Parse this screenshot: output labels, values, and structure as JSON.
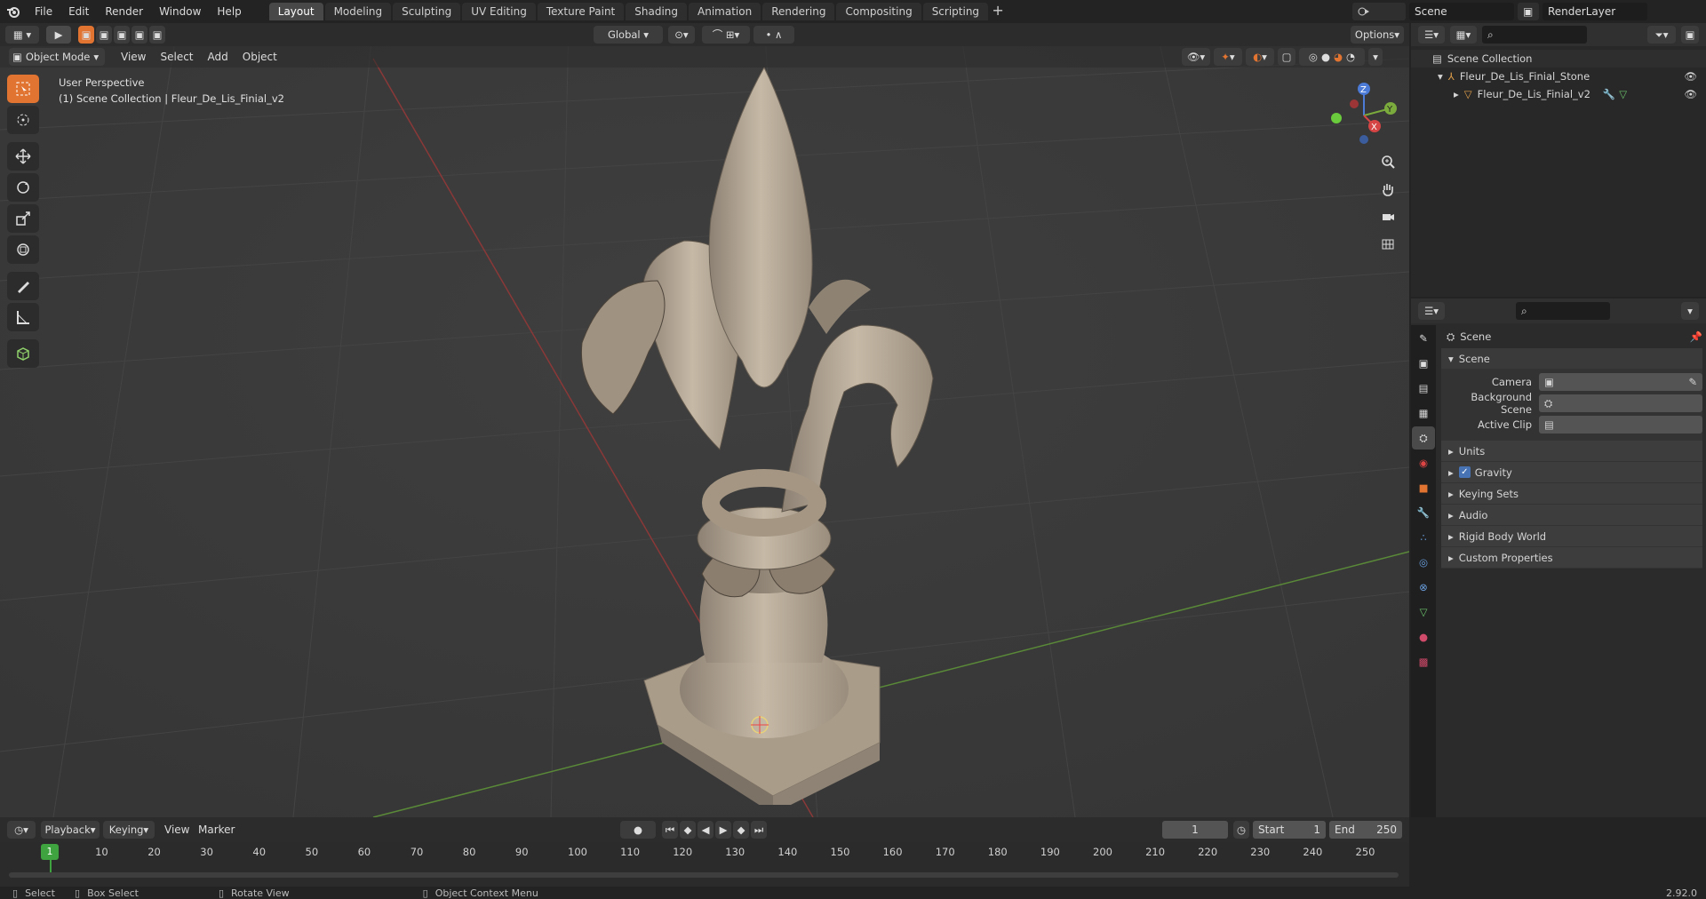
{
  "app": {
    "version": "2.92.0"
  },
  "menu": [
    {
      "label": "File"
    },
    {
      "label": "Edit"
    },
    {
      "label": "Render"
    },
    {
      "label": "Window"
    },
    {
      "label": "Help"
    }
  ],
  "workspaces": [
    {
      "label": "Layout",
      "active": true
    },
    {
      "label": "Modeling"
    },
    {
      "label": "Sculpting"
    },
    {
      "label": "UV Editing"
    },
    {
      "label": "Texture Paint"
    },
    {
      "label": "Shading"
    },
    {
      "label": "Animation"
    },
    {
      "label": "Rendering"
    },
    {
      "label": "Compositing"
    },
    {
      "label": "Scripting"
    }
  ],
  "topright": {
    "scene": "Scene",
    "view_layer": "RenderLayer"
  },
  "viewport_header": {
    "mode": "Object Mode",
    "menus": [
      "View",
      "Select",
      "Add",
      "Object"
    ],
    "orientation": "Global",
    "options": "Options"
  },
  "viewport": {
    "perspective": "User Perspective",
    "collection_path": "(1) Scene Collection | Fleur_De_Lis_Finial_v2",
    "gizmo": {
      "x": "X",
      "y": "Y",
      "z": "Z"
    }
  },
  "outliner": {
    "root": "Scene Collection",
    "items": [
      {
        "label": "Fleur_De_Lis_Finial_Stone"
      },
      {
        "label": "Fleur_De_Lis_Finial_v2"
      }
    ]
  },
  "properties": {
    "context": "Scene",
    "panel": "Scene",
    "fields": [
      {
        "label": "Camera"
      },
      {
        "label": "Background Scene"
      },
      {
        "label": "Active Clip"
      }
    ],
    "subpanels": [
      {
        "label": "Units"
      },
      {
        "label": "Gravity",
        "checked": true
      },
      {
        "label": "Keying Sets"
      },
      {
        "label": "Audio"
      },
      {
        "label": "Rigid Body World"
      },
      {
        "label": "Custom Properties"
      }
    ]
  },
  "timeline": {
    "menus": [
      "Playback",
      "Keying",
      "View",
      "Marker"
    ],
    "current_frame": "1",
    "start_label": "Start",
    "start": "1",
    "end_label": "End",
    "end": "250",
    "ticks": [
      "10",
      "20",
      "30",
      "40",
      "50",
      "60",
      "70",
      "80",
      "90",
      "100",
      "110",
      "120",
      "130",
      "140",
      "150",
      "160",
      "170",
      "180",
      "190",
      "200",
      "210",
      "220",
      "230",
      "240",
      "250"
    ],
    "playhead_label": "1"
  },
  "status": {
    "select": "Select",
    "box_select": "Box Select",
    "rotate": "Rotate View",
    "context": "Object Context Menu",
    "version": "2.92.0"
  },
  "colors": {
    "accent": "#e27431",
    "selected_blue": "#4772b3",
    "playhead": "#3fa33f"
  }
}
